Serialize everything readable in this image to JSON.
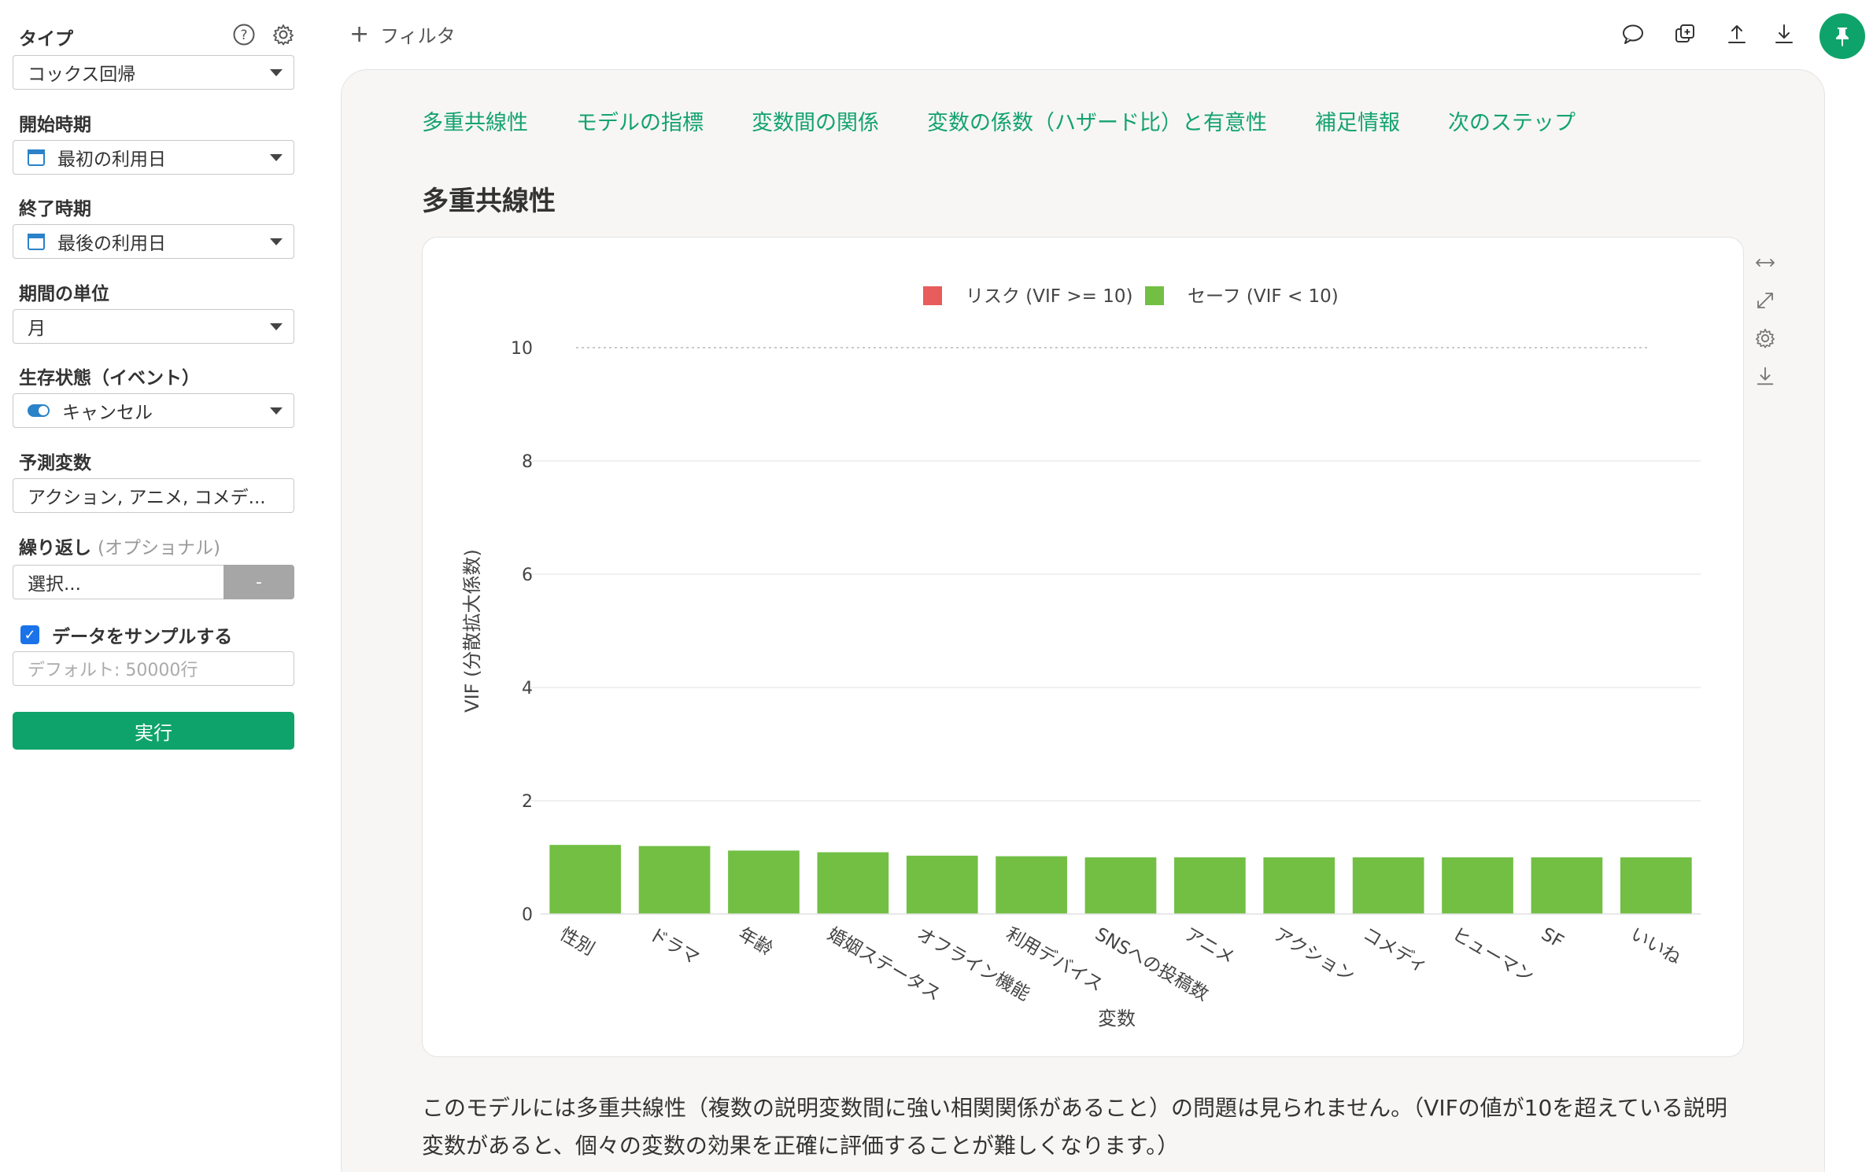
{
  "sidebar": {
    "type_label": "タイプ",
    "type_value": "コックス回帰",
    "start_label": "開始時期",
    "start_value": "最初の利用日",
    "end_label": "終了時期",
    "end_value": "最後の利用日",
    "unit_label": "期間の単位",
    "unit_value": "月",
    "event_label": "生存状態（イベント）",
    "event_value": "キャンセル",
    "predictor_label": "予測変数",
    "predictor_value": "アクション, アニメ, コメデ...",
    "repeat_label": "繰り返し",
    "repeat_optional": "(オプショナル)",
    "repeat_value": "選択...",
    "repeat_button": "-",
    "sample_label": "データをサンプルする",
    "sample_checked": true,
    "sample_placeholder": "デフォルト: 50000行",
    "run_label": "実行"
  },
  "topbar": {
    "filter_label": "フィルタ",
    "icons": [
      "comment-icon",
      "copy-icon",
      "upload-icon",
      "download-icon",
      "pin-icon"
    ]
  },
  "tabs": [
    {
      "label": "多重共線性"
    },
    {
      "label": "モデルの指標"
    },
    {
      "label": "変数間の関係"
    },
    {
      "label": "変数の係数（ハザード比）と有意性"
    },
    {
      "label": "補足情報"
    },
    {
      "label": "次のステップ"
    }
  ],
  "section_title": "多重共線性",
  "chart_tools": [
    "expand-horizontal-icon",
    "fullscreen-icon",
    "gear-icon",
    "download-icon"
  ],
  "chart_data": {
    "type": "bar",
    "xlabel": "変数",
    "ylabel": "VIF (分散拡大係数)",
    "ylim": [
      0,
      10
    ],
    "yticks": [
      0,
      2,
      4,
      6,
      8,
      10
    ],
    "threshold": 10,
    "legend": [
      {
        "name": "リスク (VIF >= 10)",
        "color": "#e85c5c"
      },
      {
        "name": "セーフ (VIF < 10)",
        "color": "#72bf44"
      }
    ],
    "legend_position": "top-center",
    "grid": true,
    "categories": [
      "性別",
      "ドラマ",
      "年齢",
      "婚姻ステータス",
      "オフライン機能",
      "利用デバイス",
      "SNSへの投稿数",
      "アニメ",
      "アクション",
      "コメディ",
      "ヒューマン",
      "SF",
      "いいね"
    ],
    "values": [
      1.22,
      1.2,
      1.12,
      1.09,
      1.03,
      1.02,
      1.0,
      1.0,
      1.0,
      1.0,
      1.0,
      1.0,
      1.0
    ],
    "bar_color": "#72bf44"
  },
  "description": "このモデルには多重共線性（複数の説明変数間に強い相関関係があること）の問題は見られません。（VIFの値が10を超えている説明変数があると、個々の変数の効果を正確に評価することが難しくなります。）"
}
